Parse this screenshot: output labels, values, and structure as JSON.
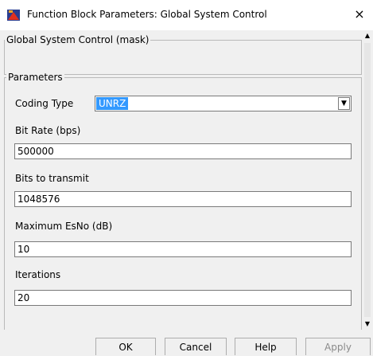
{
  "window": {
    "title": "Function Block Parameters: Global System Control",
    "close_glyph": "×",
    "icon": "simulink-icon"
  },
  "mask_group": {
    "legend": "Global System Control (mask)"
  },
  "parameters_group": {
    "legend": "Parameters",
    "coding_type": {
      "label": "Coding Type",
      "value": "UNRZ"
    },
    "bit_rate": {
      "label": "Bit Rate (bps)",
      "value": "500000"
    },
    "bits_to_transmit": {
      "label": "Bits to transmit",
      "value": "1048576"
    },
    "max_esno": {
      "label": "Maximum EsNo (dB)",
      "value": "10"
    },
    "iterations": {
      "label": "Iterations",
      "value": "20"
    }
  },
  "buttons": {
    "ok": "OK",
    "cancel": "Cancel",
    "help": "Help",
    "apply": "Apply"
  },
  "colors": {
    "selection": "#3399ff",
    "background": "#f0f0f0"
  }
}
